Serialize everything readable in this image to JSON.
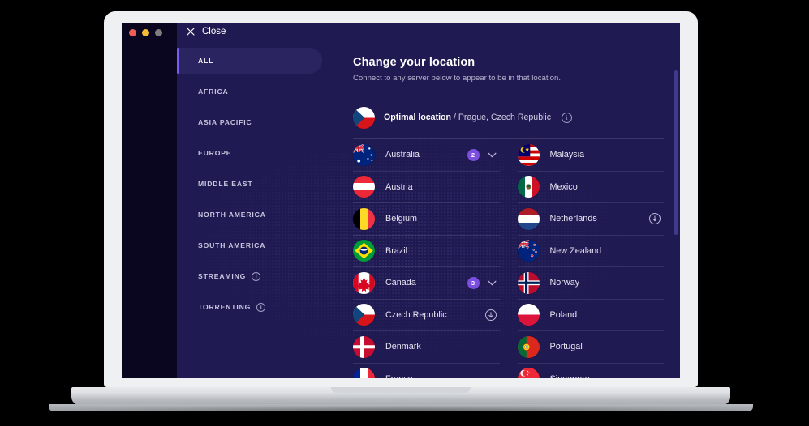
{
  "window": {
    "traffic_lights": [
      "close-red",
      "minimize-yellow",
      "zoom-grey"
    ],
    "close_label": "Close"
  },
  "sidebar": {
    "items": [
      {
        "label": "ALL",
        "active": true,
        "info": false
      },
      {
        "label": "AFRICA",
        "active": false,
        "info": false
      },
      {
        "label": "ASIA PACIFIC",
        "active": false,
        "info": false
      },
      {
        "label": "EUROPE",
        "active": false,
        "info": false
      },
      {
        "label": "MIDDLE EAST",
        "active": false,
        "info": false
      },
      {
        "label": "NORTH AMERICA",
        "active": false,
        "info": false
      },
      {
        "label": "SOUTH AMERICA",
        "active": false,
        "info": false
      },
      {
        "label": "STREAMING",
        "active": false,
        "info": true
      },
      {
        "label": "TORRENTING",
        "active": false,
        "info": true
      }
    ]
  },
  "main": {
    "title": "Change your location",
    "subtitle": "Connect to any server below to appear to be in that location.",
    "optimal": {
      "label": "Optimal location",
      "separator": " / ",
      "detail": "Prague, Czech Republic",
      "info_glyph": "i",
      "flag": "cz"
    },
    "info_glyph": "i"
  },
  "countries": {
    "left": [
      {
        "name": "Australia",
        "flag": "au",
        "badge": "2",
        "chevron": true,
        "download": false
      },
      {
        "name": "Austria",
        "flag": "at",
        "badge": null,
        "chevron": false,
        "download": false
      },
      {
        "name": "Belgium",
        "flag": "be",
        "badge": null,
        "chevron": false,
        "download": false
      },
      {
        "name": "Brazil",
        "flag": "br",
        "badge": null,
        "chevron": false,
        "download": false
      },
      {
        "name": "Canada",
        "flag": "ca",
        "badge": "3",
        "chevron": true,
        "download": false
      },
      {
        "name": "Czech Republic",
        "flag": "cz",
        "badge": null,
        "chevron": false,
        "download": true
      },
      {
        "name": "Denmark",
        "flag": "dk",
        "badge": null,
        "chevron": false,
        "download": false
      },
      {
        "name": "France",
        "flag": "fr",
        "badge": null,
        "chevron": false,
        "download": false
      }
    ],
    "right": [
      {
        "name": "Malaysia",
        "flag": "my",
        "badge": null,
        "chevron": false,
        "download": false
      },
      {
        "name": "Mexico",
        "flag": "mx",
        "badge": null,
        "chevron": false,
        "download": false
      },
      {
        "name": "Netherlands",
        "flag": "nl",
        "badge": null,
        "chevron": false,
        "download": true
      },
      {
        "name": "New Zealand",
        "flag": "nz",
        "badge": null,
        "chevron": false,
        "download": false
      },
      {
        "name": "Norway",
        "flag": "no",
        "badge": null,
        "chevron": false,
        "download": false
      },
      {
        "name": "Poland",
        "flag": "pl",
        "badge": null,
        "chevron": false,
        "download": false
      },
      {
        "name": "Portugal",
        "flag": "pt",
        "badge": null,
        "chevron": false,
        "download": false
      },
      {
        "name": "Singapore",
        "flag": "sg",
        "badge": null,
        "chevron": false,
        "download": false
      }
    ]
  },
  "colors": {
    "app_background": "#201a52",
    "rail_background": "#0b0620",
    "accent_purple": "#7b5cf0",
    "badge_purple": "#7c4ee0",
    "active_pill": "#2a2461",
    "text_primary": "#ffffff",
    "text_muted": "#b6b4cf",
    "scrollbar_thumb": "#41398a",
    "laptop_body": "#eef0f2"
  }
}
